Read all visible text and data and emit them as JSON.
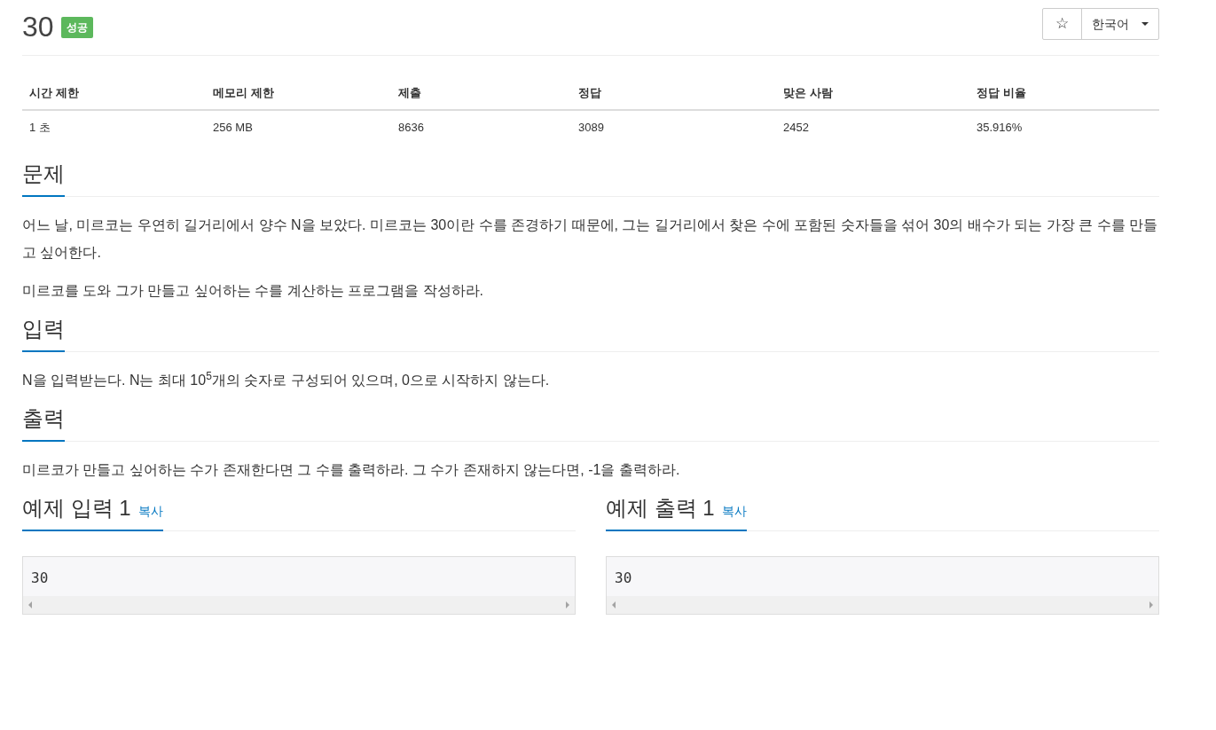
{
  "title": "30",
  "badge": "성공",
  "star": "☆",
  "language": "한국어",
  "stats": {
    "columns": [
      "시간 제한",
      "메모리 제한",
      "제출",
      "정답",
      "맞은 사람",
      "정답 비율"
    ],
    "row": [
      "1 초",
      "256 MB",
      "8636",
      "3089",
      "2452",
      "35.916%"
    ]
  },
  "sections": [
    {
      "heading": "문제",
      "paragraphs": [
        "어느 날, 미르코는 우연히 길거리에서 양수 N을 보았다. 미르코는 30이란 수를 존경하기 때문에, 그는 길거리에서 찾은 수에 포함된 숫자들을 섞어 30의 배수가 되는 가장 큰 수를 만들고 싶어한다.",
        "미르코를 도와 그가 만들고 싶어하는 수를 계산하는 프로그램을 작성하라."
      ]
    },
    {
      "heading": "입력",
      "paragraphs": [
        "N을 입력받는다. N는 최대 10$^{5}$개의 숫자로 구성되어 있으며, 0으로 시작하지 않는다."
      ]
    },
    {
      "heading": "출력",
      "paragraphs": [
        "미르코가 만들고 싶어하는 수가 존재한다면 그 수를 출력하라. 그 수가 존재하지 않는다면, -1을 출력하라."
      ]
    }
  ],
  "samples": [
    {
      "heading": "예제 입력 1",
      "copy": "복사",
      "content": "30"
    },
    {
      "heading": "예제 출력 1",
      "copy": "복사",
      "content": "30"
    }
  ]
}
